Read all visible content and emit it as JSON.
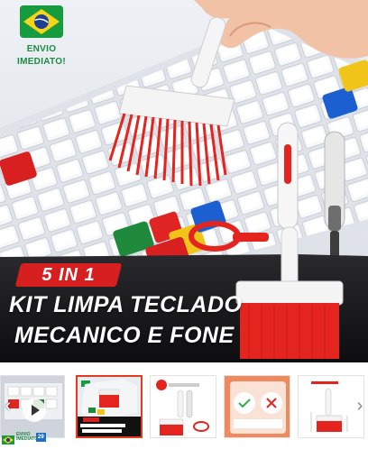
{
  "product_image": {
    "shipping_badge": {
      "line1": "ENVIO",
      "line2": "IMEDIATO!"
    },
    "badge": "5 IN 1",
    "title_line1": "KIT LIMPA TECLADO",
    "title_line2": "MECANICO E FONE",
    "icons": [
      "brazil-flag-icon",
      "keyboard",
      "cleaning-brush",
      "cleaning-pen",
      "keycap-puller"
    ],
    "colors": {
      "accent_red": "#d81f1f",
      "brand_green": "#1d8a43",
      "keyboard_white": "#f4f5f7"
    }
  },
  "gallery": {
    "thumbnails": [
      {
        "label": "video",
        "selected": false
      },
      {
        "label": "image-1",
        "selected": true
      },
      {
        "label": "image-2",
        "selected": false
      },
      {
        "label": "image-3",
        "selected": false
      },
      {
        "label": "image-4",
        "selected": false
      }
    ],
    "thumb1_ship": "ENVIO IMEDIATO",
    "thumb1_date": "29",
    "prev_icon": "chevron-left-icon",
    "next_icon": "chevron-right-icon"
  }
}
